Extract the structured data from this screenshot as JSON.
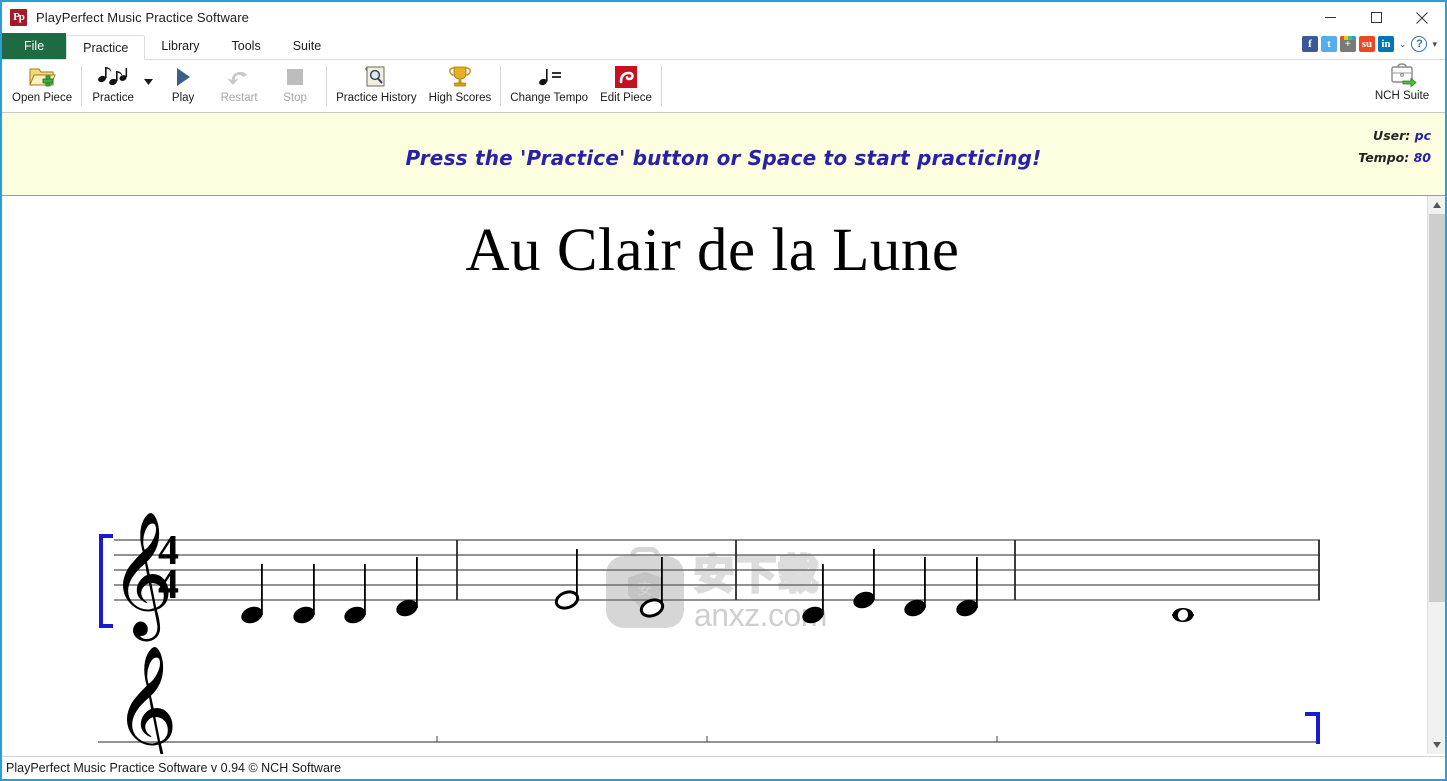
{
  "window": {
    "title": "PlayPerfect Music Practice Software",
    "app_icon": "Pp",
    "minimize_label": "—",
    "maximize_label": "□",
    "close_label": "✕"
  },
  "menu": {
    "tabs": [
      {
        "label": "File",
        "active": false,
        "kind": "file"
      },
      {
        "label": "Practice",
        "active": true,
        "kind": "tab"
      },
      {
        "label": "Library",
        "active": false,
        "kind": "tab"
      },
      {
        "label": "Tools",
        "active": false,
        "kind": "tab"
      },
      {
        "label": "Suite",
        "active": false,
        "kind": "tab"
      }
    ],
    "social": [
      {
        "name": "facebook-icon",
        "glyph": "f"
      },
      {
        "name": "twitter-icon",
        "glyph": "t"
      },
      {
        "name": "share-plus-icon",
        "glyph": "+"
      },
      {
        "name": "stumbleupon-icon",
        "glyph": "su"
      },
      {
        "name": "linkedin-icon",
        "glyph": "in"
      }
    ],
    "chevron": "⌄",
    "help": "?",
    "help_dropdown": "▾"
  },
  "toolbar": {
    "items": [
      {
        "label": "Open Piece",
        "icon": "open-folder-icon",
        "disabled": false
      },
      {
        "label": "Practice",
        "icon": "music-notes-icon",
        "disabled": false,
        "has_dropdown": true
      },
      {
        "label": "Play",
        "icon": "play-triangle-icon",
        "disabled": false
      },
      {
        "label": "Restart",
        "icon": "undo-arrow-icon",
        "disabled": true
      },
      {
        "label": "Stop",
        "icon": "stop-square-icon",
        "disabled": true
      },
      {
        "label": "Practice History",
        "icon": "scroll-magnifier-icon",
        "disabled": false
      },
      {
        "label": "High Scores",
        "icon": "trophy-icon",
        "disabled": false
      },
      {
        "label": "Change Tempo",
        "icon": "metronome-note-icon",
        "disabled": false
      },
      {
        "label": "Edit Piece",
        "icon": "edit-piece-icon",
        "disabled": false
      }
    ],
    "nch_suite": {
      "label": "NCH Suite",
      "icon": "briefcase-icon"
    }
  },
  "banner": {
    "message": "Press the 'Practice' button or Space to start practicing!",
    "user_label": "User:",
    "user_value": "pc",
    "tempo_label": "Tempo:",
    "tempo_value": "80",
    "background_color": "#FDFDE0",
    "text_color": "#2A22A5"
  },
  "score": {
    "title": "Au Clair de la Lune",
    "clef": "treble-clef",
    "time_signature": {
      "numerator": "4",
      "denominator": "4"
    },
    "bracket_color": "#1a1ad0",
    "systems": [
      {
        "measures": [
          {
            "notes": [
              {
                "pitch": "C4",
                "duration": "quarter",
                "ledger": true
              },
              {
                "pitch": "C4",
                "duration": "quarter",
                "ledger": true
              },
              {
                "pitch": "C4",
                "duration": "quarter",
                "ledger": true
              },
              {
                "pitch": "D4",
                "duration": "quarter",
                "ledger": false
              }
            ]
          },
          {
            "notes": [
              {
                "pitch": "E4",
                "duration": "half",
                "ledger": false
              },
              {
                "pitch": "D4",
                "duration": "half",
                "ledger": false
              }
            ]
          },
          {
            "notes": [
              {
                "pitch": "C4",
                "duration": "quarter",
                "ledger": true
              },
              {
                "pitch": "E4",
                "duration": "quarter",
                "ledger": false
              },
              {
                "pitch": "D4",
                "duration": "quarter",
                "ledger": false
              },
              {
                "pitch": "D4",
                "duration": "quarter",
                "ledger": false
              }
            ]
          },
          {
            "notes": [
              {
                "pitch": "C4",
                "duration": "whole",
                "ledger": true
              }
            ]
          }
        ]
      }
    ]
  },
  "watermark": {
    "chinese": "安下载",
    "shield_char": "安",
    "url": "anxz.com"
  },
  "scrollbar": {
    "up_arrow": "▲",
    "down_arrow": "▼"
  },
  "statusbar": {
    "text": "PlayPerfect Music Practice Software v 0.94 © NCH Software"
  }
}
